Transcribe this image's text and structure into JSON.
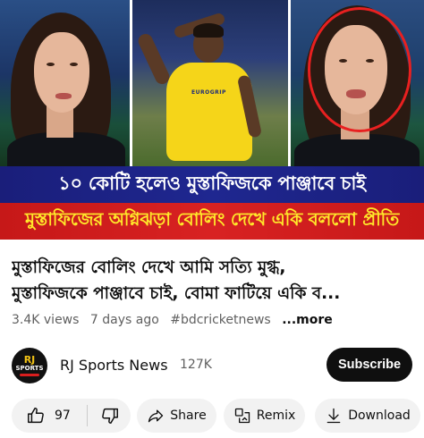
{
  "thumbnail": {
    "banner_line1": "১০ কোটি হলেও মুস্তাফিজকে পাঞ্জাবে চাই",
    "banner_line2": "মুস্তাফিজের অগ্নিঝড়া বোলিং দেখে একি বললো প্রীতি",
    "jersey_text": "EUROGRIP",
    "colors": {
      "banner_blue": "#1f2790",
      "banner_red": "#d82222",
      "banner_yellow_text": "#ffe82a",
      "highlight_circle": "#e82020"
    }
  },
  "video": {
    "title_line1": "মুস্তাফিজের বোলিং দেখে আমি সত্যি মুগ্ধ,",
    "title_line2": "মুস্তাফিজকে পাঞ্জাবে চাই, বোমা ফাটিয়ে একি ব...",
    "views": "3.4K views",
    "age": "7 days ago",
    "hashtag": "#bdcricketnews",
    "more_label": "...more"
  },
  "channel": {
    "avatar_text_top": "RJ",
    "avatar_text_bottom": "SPORTS",
    "name": "RJ Sports News",
    "subscribers": "127K",
    "subscribe_label": "Subscribe"
  },
  "actions": {
    "like_count": "97",
    "like_icon": "thumbs-up-icon",
    "dislike_icon": "thumbs-down-icon",
    "share_label": "Share",
    "share_icon": "share-arrow-icon",
    "remix_label": "Remix",
    "remix_icon": "remix-icon",
    "download_label": "Download",
    "download_icon": "download-icon"
  }
}
